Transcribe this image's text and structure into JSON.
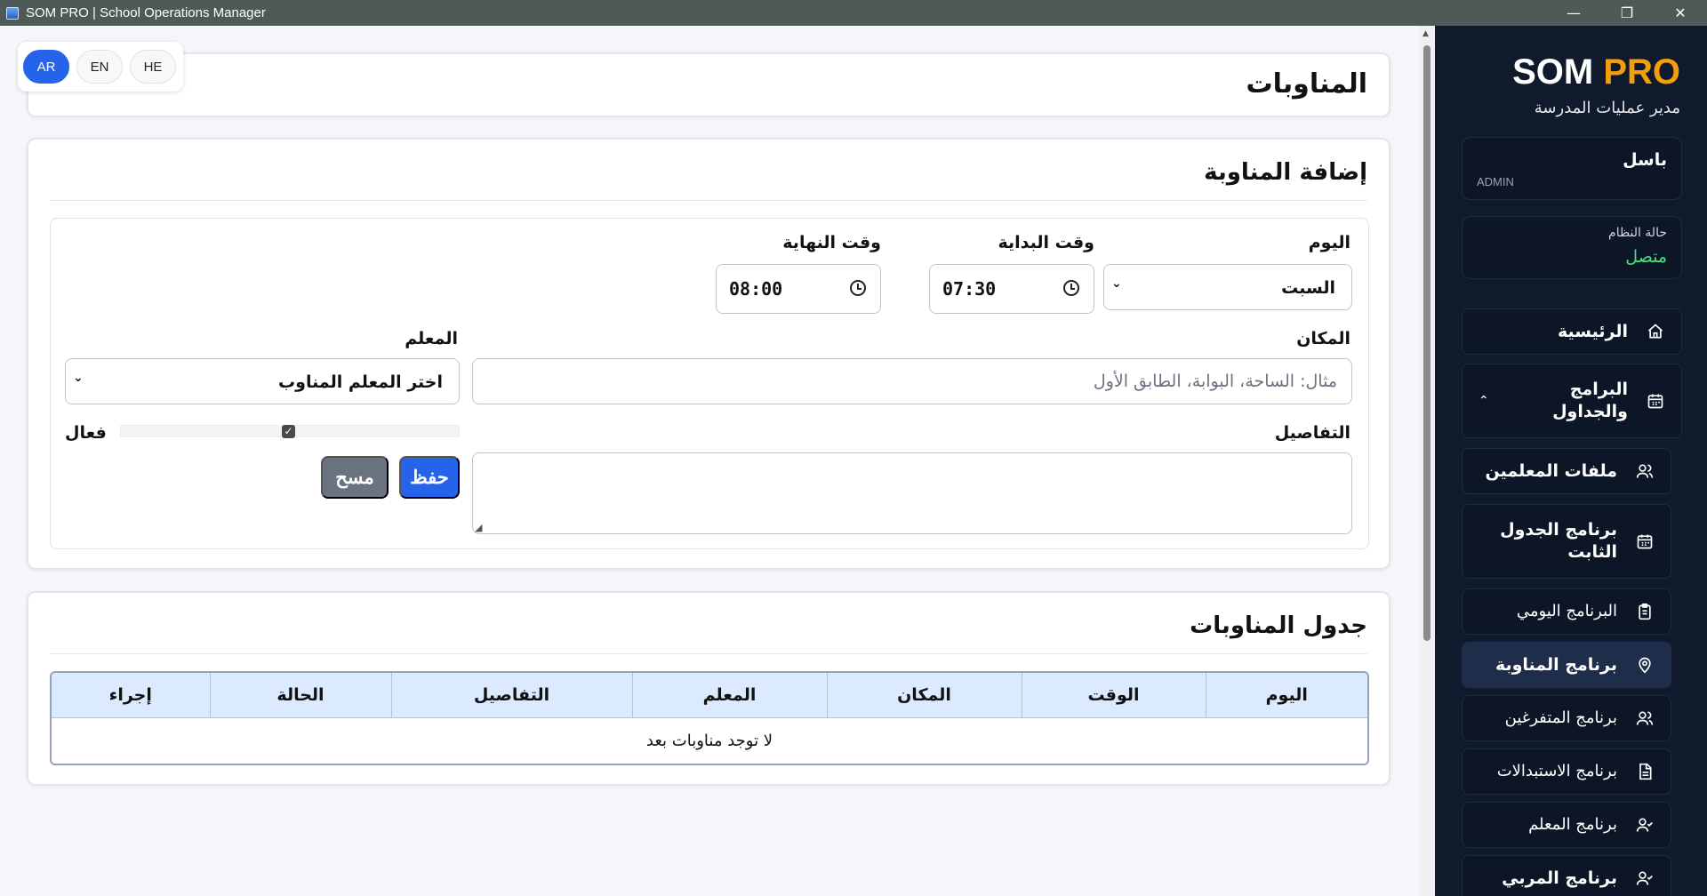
{
  "window": {
    "title": "SOM PRO | School Operations Manager",
    "minimize": "—",
    "restore": "❐",
    "close": "✕"
  },
  "lang": {
    "ar": "AR",
    "en": "EN",
    "he": "HE",
    "active": "AR"
  },
  "page": {
    "title": "المناوبات"
  },
  "form": {
    "section_title": "إضافة المناوبة",
    "day_label": "اليوم",
    "day_value": "السبت",
    "start_label": "وقت البداية",
    "start_value": "07:30",
    "end_label": "وقت النهاية",
    "end_value": "08:00",
    "location_label": "المكان",
    "location_placeholder": "مثال: الساحة، البوابة، الطابق الأول",
    "teacher_label": "المعلم",
    "teacher_value": "اختر المعلم المناوب",
    "details_label": "التفاصيل",
    "active_label": "فعال",
    "active_checked": true,
    "save_label": "حفظ",
    "clear_label": "مسح"
  },
  "table": {
    "section_title": "جدول المناوبات",
    "headers": [
      "اليوم",
      "الوقت",
      "المكان",
      "المعلم",
      "التفاصيل",
      "الحالة",
      "إجراء"
    ],
    "empty_text": "لا توجد مناوبات بعد"
  },
  "sidebar": {
    "brand_a": "SOM",
    "brand_b": "PRO",
    "brand_sub": "مدير عمليات المدرسة",
    "user_name": "باسل",
    "user_role": "ADMIN",
    "system_label": "حالة النظام",
    "system_value": "متصل",
    "items": [
      {
        "label": "الرئيسية"
      },
      {
        "label": "البرامج والجداول"
      },
      {
        "label": "ملفات المعلمين"
      },
      {
        "label": "برنامج الجدول الثابت"
      },
      {
        "label": "البرنامج اليومي"
      },
      {
        "label": "برنامج المناوبة"
      },
      {
        "label": "برنامج المتفرغين"
      },
      {
        "label": "برنامج الاستبدالات"
      },
      {
        "label": "برنامج المعلم"
      },
      {
        "label": "برنامج المربي"
      }
    ]
  },
  "colors": {
    "accent": "#2563eb",
    "brand_orange": "#f59e0b",
    "sidebar_bg": "#0f1b2d",
    "status_green": "#4ade80",
    "table_header": "#dbeafe"
  }
}
